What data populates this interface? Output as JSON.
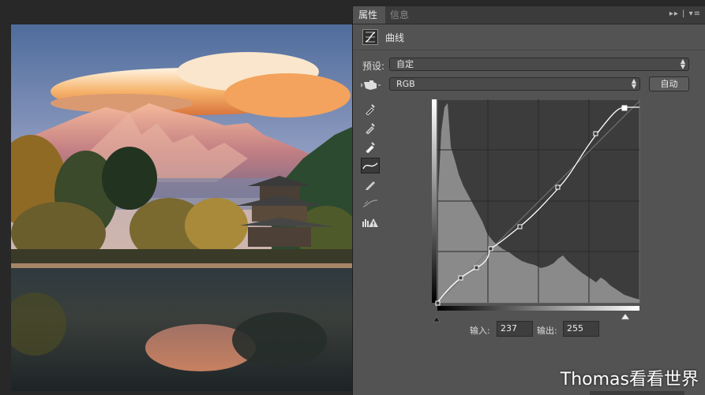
{
  "tabs": [
    {
      "label": "属性",
      "active": true
    },
    {
      "label": "信息",
      "active": false
    }
  ],
  "panel_menu_icon": "double-chevron-menu-icon",
  "panel": {
    "title": "曲线",
    "preset_label": "预设:",
    "preset_value": "自定",
    "channel_value": "RGB",
    "auto_label": "自动"
  },
  "tools": [
    "hand-target-icon",
    "black-eyedropper-icon",
    "gray-eyedropper-icon",
    "white-eyedropper-icon",
    "curve-tool-icon",
    "pencil-icon",
    "smooth-curve-icon",
    "clipping-warning-icon"
  ],
  "curve": {
    "input_label": "输入:",
    "input_value": "237",
    "output_label": "输出:",
    "output_value": "255"
  },
  "watermark": "Thomas看看世界",
  "colors": {
    "panel_bg": "#535353",
    "graph_bg": "#3c3c3c",
    "histogram": "#8a8a8a",
    "curve_line": "#ffffff"
  }
}
